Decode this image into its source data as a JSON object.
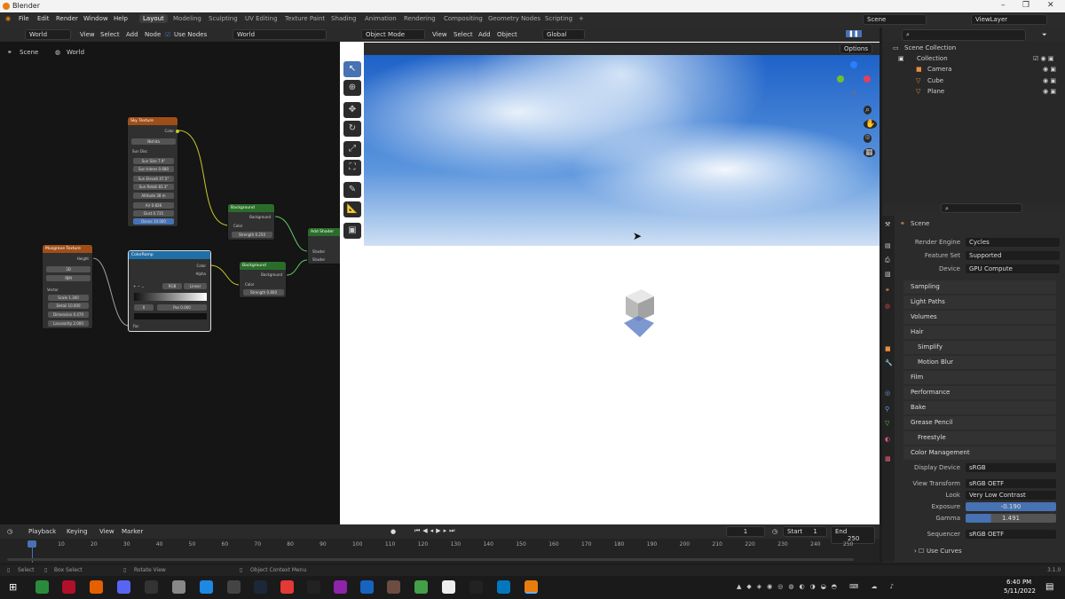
{
  "window": {
    "title": "Blender"
  },
  "menubar": {
    "items": [
      "File",
      "Edit",
      "Render",
      "Window",
      "Help"
    ]
  },
  "workspaces": [
    "Layout",
    "Modeling",
    "Sculpting",
    "UV Editing",
    "Texture Paint",
    "Shading",
    "Animation",
    "Rendering",
    "Compositing",
    "Geometry Nodes",
    "Scripting"
  ],
  "scene_field": "Scene",
  "viewlayer_field": "ViewLayer",
  "node_editor": {
    "world_dropdown": "World",
    "menus": [
      "View",
      "Select",
      "Add",
      "Node"
    ],
    "use_nodes_label": "Use Nodes",
    "world_name": "World",
    "breadcrumb": [
      "Scene",
      "World"
    ],
    "nodes": {
      "sky": {
        "title": "Sky Texture",
        "output": "Color",
        "type": "Nishita",
        "sun_disc": "Sun Disc",
        "sun_size": "Sun Size   7.9°",
        "sun_intensity": "Sun Intens  0.680",
        "sun_elevation": "Sun Elevati  47.5°",
        "sun_rotation": "Sun Rotati  83.3°",
        "altitude": "Altitude   38 m",
        "air": "Air   0.828",
        "dust": "Dust   0.735",
        "ozone": "Ozone   10.000"
      },
      "bg1": {
        "title": "Background",
        "output": "Background",
        "color": "Color",
        "strength": "Strength  0.250"
      },
      "bg2": {
        "title": "Background",
        "output": "Background",
        "color": "Color",
        "strength": "Strength  0.800"
      },
      "add": {
        "title": "Add Shader",
        "in1": "Shader",
        "in2": "Shader"
      },
      "musgrave": {
        "title": "Musgrave Texture",
        "output": "Height",
        "dim": "3D",
        "type": "fBM",
        "vector": "Vector",
        "scale": "Scale   1.300",
        "detail": "Detail   10.000",
        "dimension": "Dimension  0.470",
        "lacunarity": "Lacunarity  2.000"
      },
      "ramp": {
        "title": "ColorRamp",
        "out_color": "Color",
        "out_alpha": "Alpha",
        "mode": "RGB",
        "interp": "Linear",
        "index": "0",
        "pos": "Pos   0.000",
        "fac": "Fac"
      }
    }
  },
  "viewport": {
    "mode": "Object Mode",
    "menus": [
      "View",
      "Select",
      "Add",
      "Object"
    ],
    "orientation": "Global",
    "options": "Options"
  },
  "outliner": {
    "root": "Scene Collection",
    "collection": "Collection",
    "items": [
      "Camera",
      "Cube",
      "Plane"
    ]
  },
  "properties": {
    "context": "Scene",
    "render_engine_label": "Render Engine",
    "render_engine": "Cycles",
    "feature_set_label": "Feature Set",
    "feature_set": "Supported",
    "device_label": "Device",
    "device": "GPU Compute",
    "sections": [
      "Sampling",
      "Light Paths",
      "Volumes",
      "Hair",
      "Simplify",
      "Motion Blur",
      "Film",
      "Performance",
      "Bake",
      "Grease Pencil",
      "Freestyle",
      "Color Management"
    ],
    "cm": {
      "display_device_label": "Display Device",
      "display_device": "sRGB",
      "view_transform_label": "View Transform",
      "view_transform": "sRGB OETF",
      "look_label": "Look",
      "look": "Very Low Contrast",
      "exposure_label": "Exposure",
      "exposure": "-0.190",
      "gamma_label": "Gamma",
      "gamma": "1.491",
      "sequencer_label": "Sequencer",
      "sequencer": "sRGB OETF",
      "use_curves": "Use Curves"
    }
  },
  "timeline": {
    "menus": [
      "Playback",
      "Keying",
      "View",
      "Marker"
    ],
    "current_frame": "1",
    "start_label": "Start",
    "start": "1",
    "end_label": "End",
    "end": "250",
    "ticks": [
      "1",
      "10",
      "20",
      "30",
      "40",
      "50",
      "60",
      "70",
      "80",
      "90",
      "100",
      "110",
      "120",
      "130",
      "140",
      "150",
      "160",
      "170",
      "180",
      "190",
      "200",
      "210",
      "220",
      "230",
      "240",
      "250"
    ]
  },
  "statusbar": {
    "select": "Select",
    "box_select": "Box Select",
    "rotate_view": "Rotate View",
    "context_menu": "Object Context Menu",
    "version": "3.1.0"
  },
  "taskbar": {
    "time": "6:40 PM",
    "date": "5/11/2022"
  }
}
